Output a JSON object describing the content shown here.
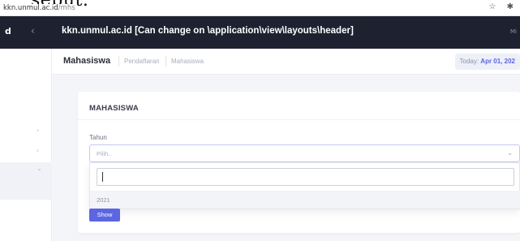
{
  "browser": {
    "cropped_text": "sebut.",
    "url_host": "kkn.unmul.ac.id",
    "url_path": "/mhs",
    "icons": [
      "star-icon",
      "extensions-icon"
    ]
  },
  "navbar": {
    "letter": "d",
    "back_icon": "chevron-left-icon",
    "title": "kkn.unmul.ac.id [Can change on \\application\\view\\layouts\\header]",
    "right_text": "Mi"
  },
  "breadcrumb": {
    "title": "Mahasiswa",
    "items": [
      "Pendaftaran",
      "Mahasiswa"
    ],
    "today_prefix": "Today: ",
    "today_date": "Apr 01, 202"
  },
  "card": {
    "title": "MAHASISWA",
    "field_label": "Tahun",
    "select_value": "Pilih..",
    "search_value": "",
    "options": [
      "2021"
    ],
    "button_label": "Show"
  },
  "colors": {
    "accent": "#5b66e0",
    "navbar": "#1e2230"
  }
}
